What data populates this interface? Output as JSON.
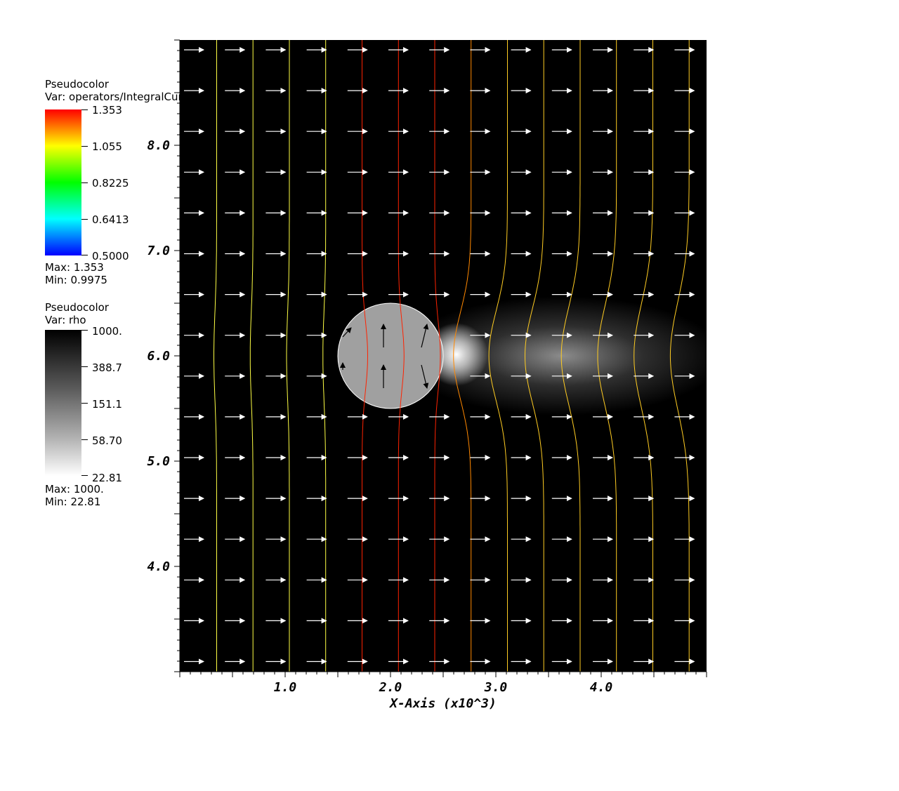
{
  "legend1": {
    "title": "Pseudocolor",
    "var": "Var: operators/IntegralCurve",
    "ticks": [
      "1.353",
      "1.055",
      "0.8225",
      "0.6413",
      "0.5000"
    ],
    "max": "Max:  1.353",
    "min": "Min:  0.9975"
  },
  "legend2": {
    "title": "Pseudocolor",
    "var": "Var: rho",
    "ticks": [
      "1000.",
      "388.7",
      "151.1",
      "58.70",
      "22.81"
    ],
    "max": "Max:  1000.",
    "min": "Min:  22.81"
  },
  "chart_data": {
    "type": "pseudocolor",
    "xlabel": "X-Axis (x10^3)",
    "ylabel": "",
    "x_ticks": [
      "1.0",
      "2.0",
      "3.0",
      "4.0"
    ],
    "y_ticks": [
      "4.0",
      "5.0",
      "6.0",
      "7.0",
      "8.0"
    ],
    "xlim": [
      0.0,
      5.0
    ],
    "ylim": [
      3.0,
      9.0
    ],
    "sphere": {
      "center": [
        2.0,
        6.0
      ],
      "radius": 0.5
    },
    "vector_glyphs": "uniform +x arrows",
    "streamline_colors": [
      "#ffff44",
      "#ffcc22",
      "#ff8800",
      "#ff2200"
    ],
    "background": "#000000"
  }
}
